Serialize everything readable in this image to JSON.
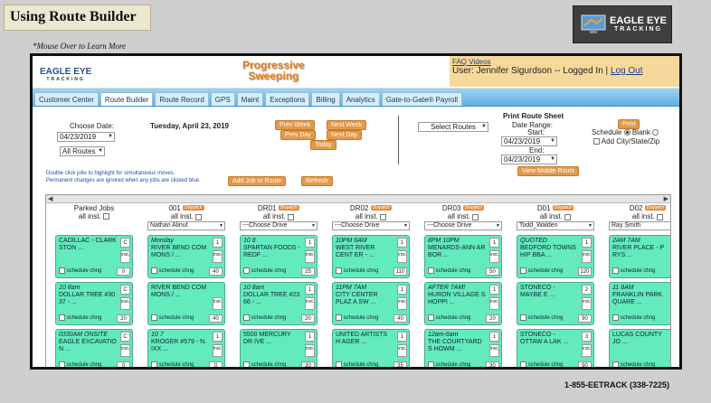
{
  "slide": {
    "title": "Using Route Builder",
    "hint": "*Mouse Over to Learn More",
    "logo_line1": "EAGLE EYE",
    "logo_line2": "TRACKING",
    "phone": "1-855-EETRACK (338-7225)"
  },
  "app": {
    "logo_main": "EAGLE EYE",
    "logo_sub": "TRACKING",
    "brand_line1": "Progressive",
    "brand_line2": "Sweeping",
    "faq": "FAQ Videos",
    "user_text": "User: Jennifer Sigurdson -- Logged In |",
    "logout": "Log Out",
    "tabs": [
      "Customer Center",
      "Route Builder",
      "Route Record",
      "GPS",
      "Maint",
      "Exceptions",
      "Billing",
      "Analytics",
      "Gate-to-Gate® Payroll"
    ],
    "active_tab": "Route Builder"
  },
  "controls": {
    "choose_date_label": "Choose Date:",
    "date_value": "04/23/2019",
    "routes_value": "All Routes",
    "current_date": "Tuesday, April 23, 2019",
    "prev_week": "Prev Week",
    "next_week": "Next Week",
    "prev_day": "Prev Day",
    "next_day": "Next Day",
    "today": "Today",
    "select_routes": "Select Routes",
    "print_title": "Print Route Sheet",
    "date_range": "Date Range:",
    "start_label": "Start:",
    "start_value": "04/23/2019",
    "end_label": "End:",
    "end_value": "04/23/2019",
    "print_btn": "Print",
    "schedule_label": "Schedule",
    "blank_label": "Blank",
    "add_city_label": "Add City/State/Zip",
    "view_mobile": "View Mobile Route",
    "note_line1": "Double click jobs to highlight for simultaneous moves.",
    "note_line2": "Permanent changes are ignored when any jobs are clicked blue.",
    "add_job": "Add Job to Route",
    "refresh": "Refresh"
  },
  "board": {
    "dispatch_label": "Dispatch",
    "all_inst": "all inst.",
    "schedule_chng": "schedule chng",
    "inst_label": "inst.",
    "columns": [
      {
        "name": "Parked Jobs",
        "badge": "",
        "driver": "",
        "cards": [
          {
            "time": "",
            "text": "CADILLAC - CLARK STON ...",
            "num": "C",
            "count": "0"
          },
          {
            "time": "10 8am",
            "text": "DOLLAR TREE #30 37 - ...",
            "num": "C",
            "count": "20"
          },
          {
            "time": "0330AM ONSITE",
            "text": "EAGLE EXCAVATIO N ...",
            "num": "C",
            "count": "0"
          }
        ]
      },
      {
        "name": "001",
        "badge": "Dispatch",
        "driver": "Nathan Alinut",
        "cards": [
          {
            "time": "Monday",
            "text": "RIVER BEND COM MONS / ...",
            "num": "1",
            "count": "40"
          },
          {
            "time": "",
            "text": "RIVER BEND COM MONS / ...",
            "num": "",
            "count": "40"
          },
          {
            "time": "10 7",
            "text": "KROGER #579 - N. IXX ...",
            "num": "1",
            "count": "0"
          }
        ]
      },
      {
        "name": "DR01",
        "badge": "Dispatch",
        "driver": "---Choose Drive",
        "cards": [
          {
            "time": "10 8",
            "text": "SPARTAN FOODS - REDF ...",
            "num": "1",
            "count": "25"
          },
          {
            "time": "10 8am",
            "text": "DOLLAR TREE #23 66 - ...",
            "num": "1",
            "count": "20"
          },
          {
            "time": "",
            "text": "5500 MERCURY DR IVE ...",
            "num": "1",
            "count": "30"
          }
        ]
      },
      {
        "name": "DR02",
        "badge": "Dispatch",
        "driver": "---Choose Drive",
        "cards": [
          {
            "time": "10PM 6AM",
            "text": "WEST RIVER CENT ER - ...",
            "num": "1",
            "count": "110"
          },
          {
            "time": "11PM 7AM",
            "text": "CITY CENTER PLAZ A SW ...",
            "num": "1",
            "count": "40"
          },
          {
            "time": "",
            "text": "UNITED ARTISTS H AGER ...",
            "num": "1",
            "count": "35"
          }
        ]
      },
      {
        "name": "DR03",
        "badge": "Dispatch",
        "driver": "---Choose Drive",
        "cards": [
          {
            "time": "8PM 10PM",
            "text": "MENARDS-ANN AR BOR ...",
            "num": "1",
            "count": "50"
          },
          {
            "time": "AFTER 7AM!",
            "text": "HURON VILLAGE S HOPPI ...",
            "num": "1",
            "count": "20"
          },
          {
            "time": "12am-6am",
            "text": "THE COURTYARD S HOWM ...",
            "num": "1",
            "count": "30"
          }
        ]
      },
      {
        "name": "D01",
        "badge": "Dispatch",
        "driver": "Todd_Walden",
        "cards": [
          {
            "time": "QUOTED",
            "text": "BEDFORD TOWNS HIP BBA ...",
            "num": "1",
            "count": "120"
          },
          {
            "time": "",
            "text": "STONECO - MAYBE E ...",
            "num": "2",
            "count": "90"
          },
          {
            "time": "",
            "text": "STONECO - OTTAW A LAK ...",
            "num": "3",
            "count": "90"
          }
        ]
      },
      {
        "name": "D02",
        "badge": "Dispatch",
        "driver": "Ray Smith",
        "cards": [
          {
            "time": "2AM 7AM",
            "text": "RIVER PLACE - P RYS ...",
            "num": "1",
            "count": "30"
          },
          {
            "time": "11 8AM",
            "text": "FRANKLIN PARK QUARE ...",
            "num": "2",
            "count": "20"
          },
          {
            "time": "",
            "text": "LUCAS COUNTY JO ...",
            "num": "3",
            "count": "20"
          }
        ]
      }
    ]
  }
}
